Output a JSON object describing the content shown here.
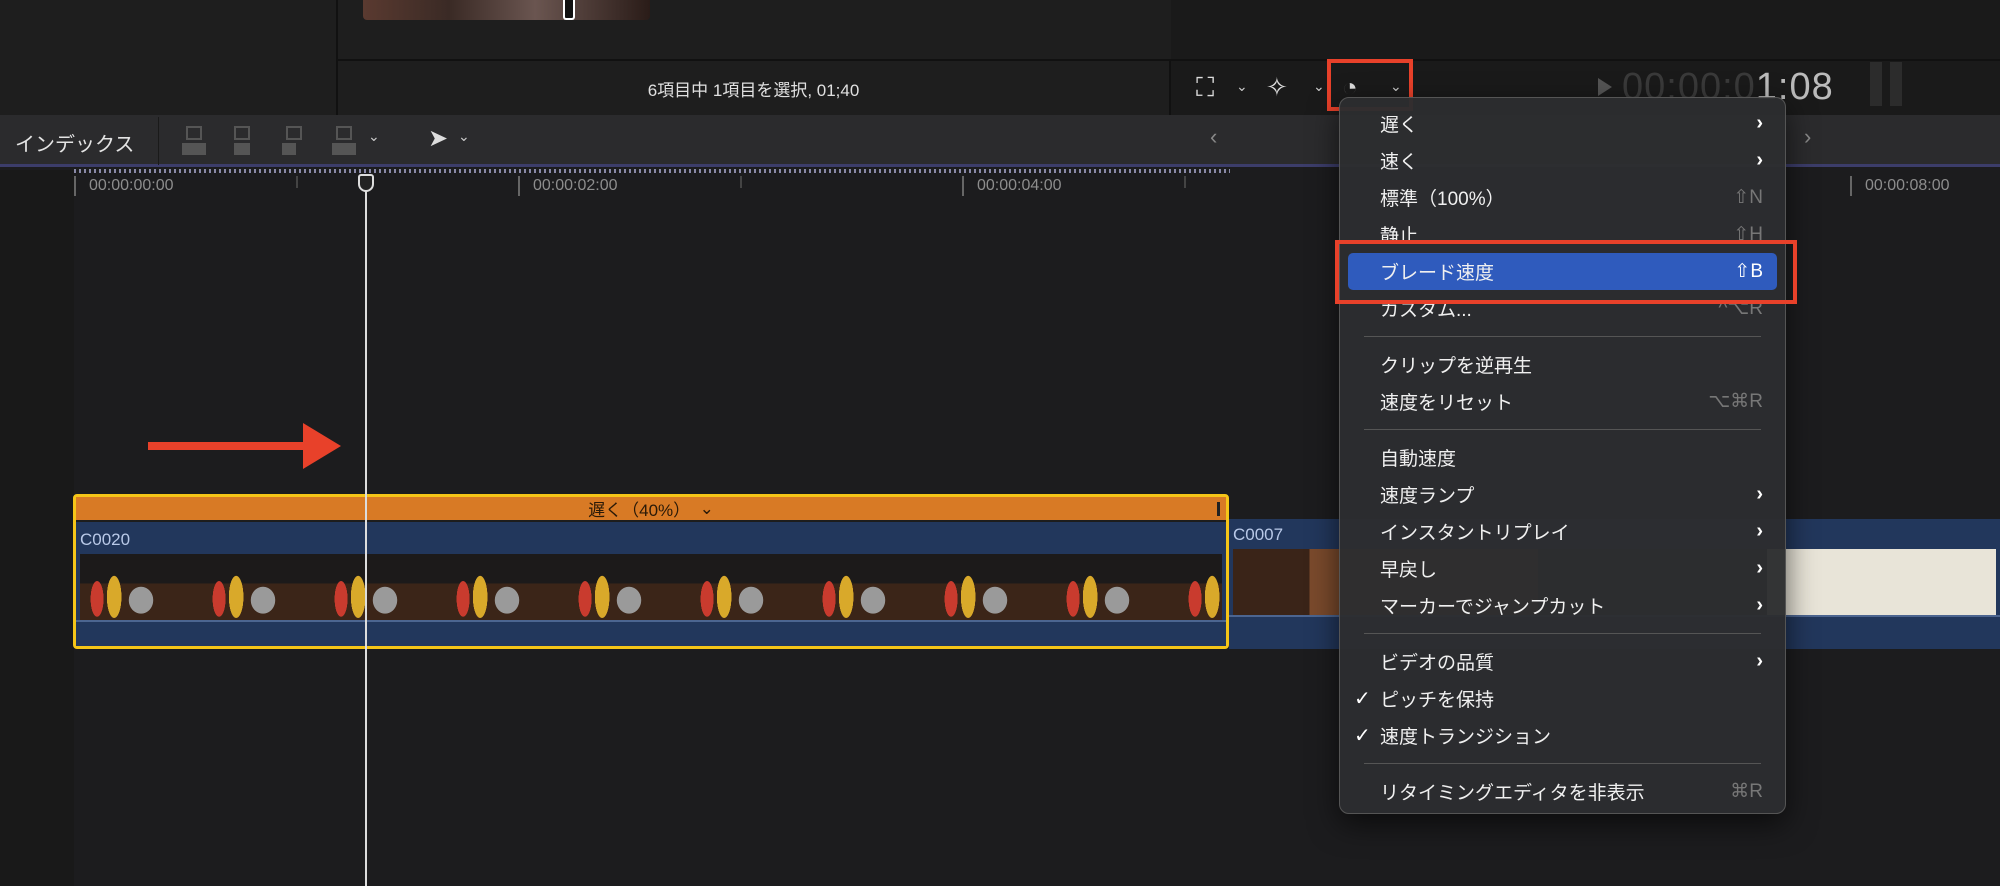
{
  "browser": {
    "status": "6項目中 1項目を選択, 01;40"
  },
  "viewer": {
    "timecode_dim": "00:00:0",
    "timecode_bright": "1:08"
  },
  "timeline_toolbar": {
    "index_label": "インデックス"
  },
  "ruler": {
    "labels": [
      "00:00:00:00",
      "00:00:02:00",
      "00:00:04:00",
      "00:00:08:00"
    ]
  },
  "clips": [
    {
      "name": "C0020",
      "retime_label": "遅く（40%）",
      "retime_chevron": "⌄",
      "selected": true
    },
    {
      "name": "C0007",
      "selected": false
    }
  ],
  "menu": {
    "items": [
      {
        "label": "遅く",
        "submenu": true
      },
      {
        "label": "速く",
        "submenu": true
      },
      {
        "label": "標準（100%）",
        "shortcut": "⇧N"
      },
      {
        "label": "静止",
        "shortcut": "⇧H"
      },
      {
        "label": "ブレード速度",
        "shortcut": "⇧B",
        "highlighted": true
      },
      {
        "label": "カスタム...",
        "shortcut": "^⌥R"
      },
      {
        "label": "クリップを逆再生"
      },
      {
        "label": "速度をリセット",
        "shortcut": "⌥⌘R"
      },
      {
        "label": "自動速度"
      },
      {
        "label": "速度ランプ",
        "submenu": true
      },
      {
        "label": "インスタントリプレイ",
        "submenu": true
      },
      {
        "label": "早戻し",
        "submenu": true
      },
      {
        "label": "マーカーでジャンプカット",
        "submenu": true
      },
      {
        "label": "ビデオの品質",
        "submenu": true
      },
      {
        "label": "ピッチを保持",
        "checked": true
      },
      {
        "label": "速度トランジション",
        "checked": true
      },
      {
        "label": "リタイミングエディタを非表示",
        "shortcut": "⌘R"
      }
    ],
    "submenu_glyph": "›",
    "check_glyph": "✓"
  },
  "colors": {
    "highlight": "#2f5bbd",
    "annotation": "#e8412a",
    "retime_bar": "#d87a25",
    "selection": "#f5c518"
  }
}
